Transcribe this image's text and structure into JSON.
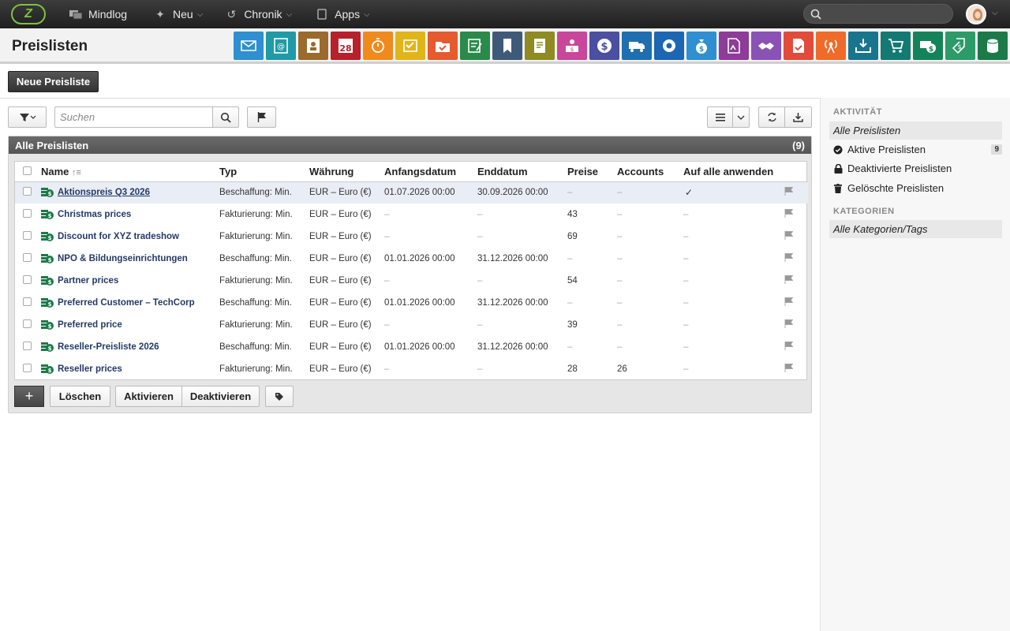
{
  "topbar": {
    "logo_text": "Z",
    "nav": [
      {
        "label": "Mindlog",
        "icon": "monitor-icon"
      },
      {
        "label": "Neu",
        "icon": "sparkle-icon"
      },
      {
        "label": "Chronik",
        "icon": "history-icon"
      },
      {
        "label": "Apps",
        "icon": "tablet-icon"
      }
    ],
    "search_placeholder": ""
  },
  "header": {
    "title": "Preislisten",
    "app_icons": [
      {
        "name": "email-icon",
        "color": "#2f8fd1"
      },
      {
        "name": "contacts-icon",
        "color": "#1f9aa6"
      },
      {
        "name": "addressbook-icon",
        "color": "#9b6a2d"
      },
      {
        "name": "calendar-icon",
        "color": "#b8202b"
      },
      {
        "name": "timer-icon",
        "color": "#f08a1c"
      },
      {
        "name": "tasks-icon",
        "color": "#e0b51a"
      },
      {
        "name": "folder-check-icon",
        "color": "#e65a30"
      },
      {
        "name": "notes-icon",
        "color": "#2a8a4a"
      },
      {
        "name": "bookmark-icon",
        "color": "#3e5a78"
      },
      {
        "name": "document-icon",
        "color": "#8f8a22"
      },
      {
        "name": "reception-icon",
        "color": "#c8479b"
      },
      {
        "name": "dollar-icon",
        "color": "#4b4fa0"
      },
      {
        "name": "truck-icon",
        "color": "#1f6fb0"
      },
      {
        "name": "support-icon",
        "color": "#1c66b4"
      },
      {
        "name": "moneybag-icon",
        "color": "#2f8fd1"
      },
      {
        "name": "contract-icon",
        "color": "#8e3b9a"
      },
      {
        "name": "handshake-icon",
        "color": "#8a52b5"
      },
      {
        "name": "pdf-check-icon",
        "color": "#e24b3b"
      },
      {
        "name": "broadcast-icon",
        "color": "#f06a2a"
      },
      {
        "name": "download-tray-icon",
        "color": "#19748e"
      },
      {
        "name": "cart-icon",
        "color": "#127a72"
      },
      {
        "name": "cash-icon",
        "color": "#14835a"
      },
      {
        "name": "pricetag-icon",
        "color": "#2c9b68"
      },
      {
        "name": "database-icon",
        "color": "#1c7a48"
      }
    ],
    "calendar_day": "28"
  },
  "new_button": "Neue Preisliste",
  "toolbar": {
    "search_placeholder": "Suchen"
  },
  "list": {
    "title": "Alle Preislisten",
    "count": "(9)",
    "columns": [
      "Name",
      "Typ",
      "Währung",
      "Anfangsdatum",
      "Enddatum",
      "Preise",
      "Accounts",
      "Auf alle anwenden"
    ],
    "rows": [
      {
        "name": "Aktionspreis Q3 2026",
        "typ": "Beschaffung: Min.",
        "waehrung": "EUR – Euro (€)",
        "start": "01.07.2026 00:00",
        "end": "30.09.2026 00:00",
        "preise": "–",
        "accounts": "–",
        "apply": "✓"
      },
      {
        "name": "Christmas prices",
        "typ": "Fakturierung: Min.",
        "waehrung": "EUR – Euro (€)",
        "start": "–",
        "end": "–",
        "preise": "43",
        "accounts": "–",
        "apply": "–"
      },
      {
        "name": "Discount for XYZ tradeshow",
        "typ": "Fakturierung: Min.",
        "waehrung": "EUR – Euro (€)",
        "start": "–",
        "end": "–",
        "preise": "69",
        "accounts": "–",
        "apply": "–"
      },
      {
        "name": "NPO & Bildungseinrichtungen",
        "typ": "Beschaffung: Min.",
        "waehrung": "EUR – Euro (€)",
        "start": "01.01.2026 00:00",
        "end": "31.12.2026 00:00",
        "preise": "–",
        "accounts": "–",
        "apply": "–"
      },
      {
        "name": "Partner prices",
        "typ": "Fakturierung: Min.",
        "waehrung": "EUR – Euro (€)",
        "start": "–",
        "end": "–",
        "preise": "54",
        "accounts": "–",
        "apply": "–"
      },
      {
        "name": "Preferred Customer – TechCorp",
        "typ": "Beschaffung: Min.",
        "waehrung": "EUR – Euro (€)",
        "start": "01.01.2026 00:00",
        "end": "31.12.2026 00:00",
        "preise": "–",
        "accounts": "–",
        "apply": "–"
      },
      {
        "name": "Preferred price",
        "typ": "Fakturierung: Min.",
        "waehrung": "EUR – Euro (€)",
        "start": "–",
        "end": "–",
        "preise": "39",
        "accounts": "–",
        "apply": "–"
      },
      {
        "name": "Reseller-Preisliste 2026",
        "typ": "Beschaffung: Min.",
        "waehrung": "EUR – Euro (€)",
        "start": "01.01.2026 00:00",
        "end": "31.12.2026 00:00",
        "preise": "–",
        "accounts": "–",
        "apply": "–"
      },
      {
        "name": "Reseller prices",
        "typ": "Fakturierung: Min.",
        "waehrung": "EUR – Euro (€)",
        "start": "–",
        "end": "–",
        "preise": "28",
        "accounts": "26",
        "apply": "–"
      }
    ]
  },
  "bottom_buttons": {
    "add": "+",
    "delete": "Löschen",
    "activate": "Aktivieren",
    "deactivate": "Deaktivieren"
  },
  "sidebar": {
    "activity_heading": "AKTIVITÄT",
    "activity_items": [
      {
        "label": "Alle Preislisten",
        "icon": ""
      },
      {
        "label": "Aktive Preislisten",
        "icon": "check-circle-icon",
        "badge": "9"
      },
      {
        "label": "Deaktivierte Preislisten",
        "icon": "lock-icon"
      },
      {
        "label": "Gelöschte Preislisten",
        "icon": "trash-icon"
      }
    ],
    "categories_heading": "KATEGORIEN",
    "category_items": [
      {
        "label": "Alle Kategorien/Tags"
      }
    ]
  }
}
